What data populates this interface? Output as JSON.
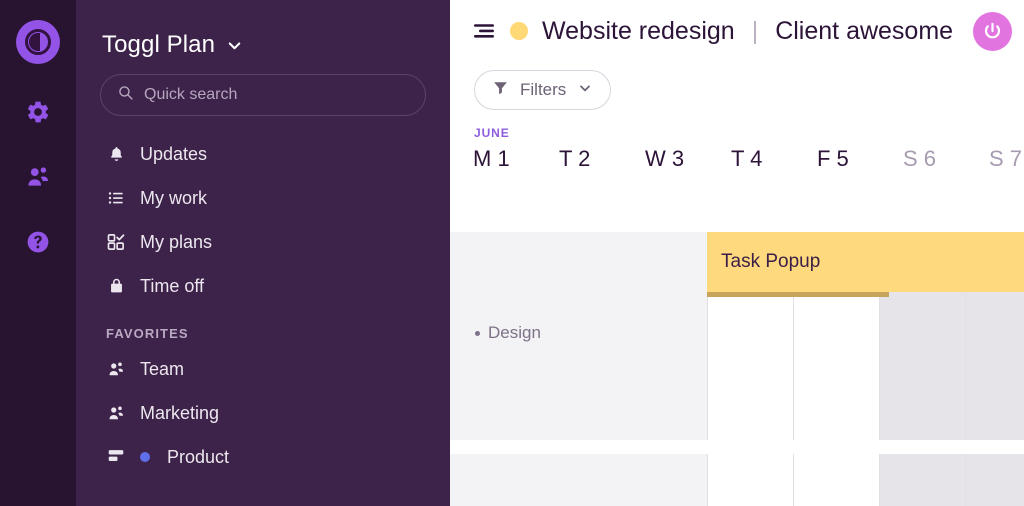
{
  "rail": {
    "items": [
      {
        "name": "toggl-logo",
        "label": "Toggl"
      },
      {
        "name": "settings",
        "label": "Settings"
      },
      {
        "name": "people",
        "label": "People"
      },
      {
        "name": "help",
        "label": "Help"
      }
    ]
  },
  "sidebar": {
    "brand": "Toggl Plan",
    "search": {
      "placeholder": "Quick search",
      "value": ""
    },
    "nav": [
      {
        "label": "Updates",
        "icon": "bell-icon"
      },
      {
        "label": "My work",
        "icon": "list-icon"
      },
      {
        "label": "My plans",
        "icon": "grid-check-icon"
      },
      {
        "label": "Time off",
        "icon": "bag-icon"
      }
    ],
    "favorites_heading": "FAVORITES",
    "favorites": [
      {
        "label": "Team",
        "icon": "people-icon",
        "dot": ""
      },
      {
        "label": "Marketing",
        "icon": "people-icon",
        "dot": ""
      },
      {
        "label": "Product",
        "icon": "board-icon",
        "dot": "#5f6fea"
      }
    ]
  },
  "header": {
    "collapse_icon": "collapse-panel-icon",
    "project_dot_color": "#ffd976",
    "project_name": "Website redesign",
    "separator": "|",
    "client_name": "Client awesome",
    "power_button": {
      "icon": "power-icon",
      "color": "#e274e0"
    }
  },
  "toolbar": {
    "filters_label": "Filters",
    "filter_icon": "funnel-icon",
    "caret_icon": "chevron-down-icon"
  },
  "timeline": {
    "month": "JUNE",
    "days": [
      {
        "dow": "M",
        "num": "1",
        "weekend": false
      },
      {
        "dow": "T",
        "num": "2",
        "weekend": false
      },
      {
        "dow": "W",
        "num": "3",
        "weekend": false
      },
      {
        "dow": "T",
        "num": "4",
        "weekend": false
      },
      {
        "dow": "F",
        "num": "5",
        "weekend": false
      },
      {
        "dow": "S",
        "num": "6",
        "weekend": true
      },
      {
        "dow": "S",
        "num": "7",
        "weekend": true
      }
    ],
    "group_label": "Design",
    "task": {
      "label": "Task Popup",
      "color": "#ffd97e",
      "progress_color": "#c6a45c",
      "start_day": "T 4",
      "progress_pct": 55
    }
  },
  "annotation": {
    "arrow_color": "#ef1010",
    "points_to": "power-button"
  }
}
